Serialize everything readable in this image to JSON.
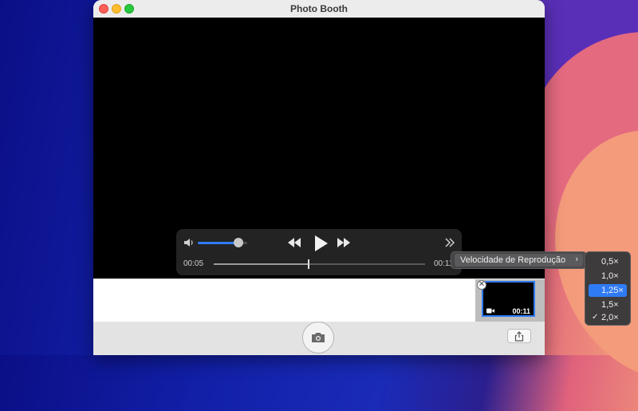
{
  "window": {
    "title": "Photo Booth"
  },
  "player": {
    "current_time": "00:05",
    "end_time": "00:11",
    "volume_level": 0.82,
    "progress": 0.45
  },
  "thumbnail": {
    "duration": "00:11",
    "close_symbol": "✕"
  },
  "context_menu": {
    "label": "Velocidade de Reprodução",
    "chevron": "›"
  },
  "speed_menu": {
    "options": [
      {
        "label": "0,5×",
        "checked": false,
        "highlighted": false
      },
      {
        "label": "1,0×",
        "checked": false,
        "highlighted": false
      },
      {
        "label": "1,25×",
        "checked": false,
        "highlighted": true
      },
      {
        "label": "1,5×",
        "checked": false,
        "highlighted": false
      },
      {
        "label": "2,0×",
        "checked": true,
        "highlighted": false
      }
    ],
    "check_symbol": "✓"
  },
  "colors": {
    "accent": "#2f7bf5",
    "video_bg": "#000000"
  }
}
